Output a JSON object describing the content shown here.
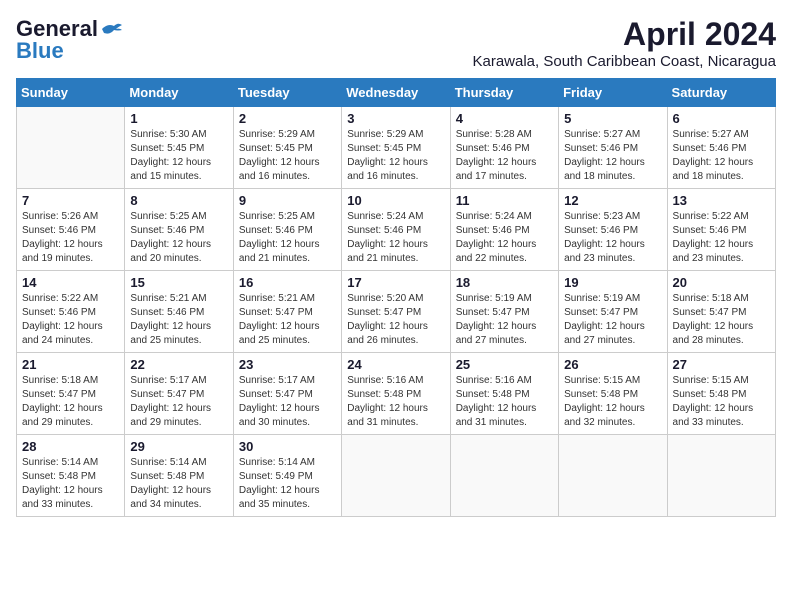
{
  "logo": {
    "general": "General",
    "blue": "Blue"
  },
  "title": "April 2024",
  "subtitle": "Karawala, South Caribbean Coast, Nicaragua",
  "headers": [
    "Sunday",
    "Monday",
    "Tuesday",
    "Wednesday",
    "Thursday",
    "Friday",
    "Saturday"
  ],
  "weeks": [
    [
      {
        "day": "",
        "info": ""
      },
      {
        "day": "1",
        "info": "Sunrise: 5:30 AM\nSunset: 5:45 PM\nDaylight: 12 hours\nand 15 minutes."
      },
      {
        "day": "2",
        "info": "Sunrise: 5:29 AM\nSunset: 5:45 PM\nDaylight: 12 hours\nand 16 minutes."
      },
      {
        "day": "3",
        "info": "Sunrise: 5:29 AM\nSunset: 5:45 PM\nDaylight: 12 hours\nand 16 minutes."
      },
      {
        "day": "4",
        "info": "Sunrise: 5:28 AM\nSunset: 5:46 PM\nDaylight: 12 hours\nand 17 minutes."
      },
      {
        "day": "5",
        "info": "Sunrise: 5:27 AM\nSunset: 5:46 PM\nDaylight: 12 hours\nand 18 minutes."
      },
      {
        "day": "6",
        "info": "Sunrise: 5:27 AM\nSunset: 5:46 PM\nDaylight: 12 hours\nand 18 minutes."
      }
    ],
    [
      {
        "day": "7",
        "info": "Sunrise: 5:26 AM\nSunset: 5:46 PM\nDaylight: 12 hours\nand 19 minutes."
      },
      {
        "day": "8",
        "info": "Sunrise: 5:25 AM\nSunset: 5:46 PM\nDaylight: 12 hours\nand 20 minutes."
      },
      {
        "day": "9",
        "info": "Sunrise: 5:25 AM\nSunset: 5:46 PM\nDaylight: 12 hours\nand 21 minutes."
      },
      {
        "day": "10",
        "info": "Sunrise: 5:24 AM\nSunset: 5:46 PM\nDaylight: 12 hours\nand 21 minutes."
      },
      {
        "day": "11",
        "info": "Sunrise: 5:24 AM\nSunset: 5:46 PM\nDaylight: 12 hours\nand 22 minutes."
      },
      {
        "day": "12",
        "info": "Sunrise: 5:23 AM\nSunset: 5:46 PM\nDaylight: 12 hours\nand 23 minutes."
      },
      {
        "day": "13",
        "info": "Sunrise: 5:22 AM\nSunset: 5:46 PM\nDaylight: 12 hours\nand 23 minutes."
      }
    ],
    [
      {
        "day": "14",
        "info": "Sunrise: 5:22 AM\nSunset: 5:46 PM\nDaylight: 12 hours\nand 24 minutes."
      },
      {
        "day": "15",
        "info": "Sunrise: 5:21 AM\nSunset: 5:46 PM\nDaylight: 12 hours\nand 25 minutes."
      },
      {
        "day": "16",
        "info": "Sunrise: 5:21 AM\nSunset: 5:47 PM\nDaylight: 12 hours\nand 25 minutes."
      },
      {
        "day": "17",
        "info": "Sunrise: 5:20 AM\nSunset: 5:47 PM\nDaylight: 12 hours\nand 26 minutes."
      },
      {
        "day": "18",
        "info": "Sunrise: 5:19 AM\nSunset: 5:47 PM\nDaylight: 12 hours\nand 27 minutes."
      },
      {
        "day": "19",
        "info": "Sunrise: 5:19 AM\nSunset: 5:47 PM\nDaylight: 12 hours\nand 27 minutes."
      },
      {
        "day": "20",
        "info": "Sunrise: 5:18 AM\nSunset: 5:47 PM\nDaylight: 12 hours\nand 28 minutes."
      }
    ],
    [
      {
        "day": "21",
        "info": "Sunrise: 5:18 AM\nSunset: 5:47 PM\nDaylight: 12 hours\nand 29 minutes."
      },
      {
        "day": "22",
        "info": "Sunrise: 5:17 AM\nSunset: 5:47 PM\nDaylight: 12 hours\nand 29 minutes."
      },
      {
        "day": "23",
        "info": "Sunrise: 5:17 AM\nSunset: 5:47 PM\nDaylight: 12 hours\nand 30 minutes."
      },
      {
        "day": "24",
        "info": "Sunrise: 5:16 AM\nSunset: 5:48 PM\nDaylight: 12 hours\nand 31 minutes."
      },
      {
        "day": "25",
        "info": "Sunrise: 5:16 AM\nSunset: 5:48 PM\nDaylight: 12 hours\nand 31 minutes."
      },
      {
        "day": "26",
        "info": "Sunrise: 5:15 AM\nSunset: 5:48 PM\nDaylight: 12 hours\nand 32 minutes."
      },
      {
        "day": "27",
        "info": "Sunrise: 5:15 AM\nSunset: 5:48 PM\nDaylight: 12 hours\nand 33 minutes."
      }
    ],
    [
      {
        "day": "28",
        "info": "Sunrise: 5:14 AM\nSunset: 5:48 PM\nDaylight: 12 hours\nand 33 minutes."
      },
      {
        "day": "29",
        "info": "Sunrise: 5:14 AM\nSunset: 5:48 PM\nDaylight: 12 hours\nand 34 minutes."
      },
      {
        "day": "30",
        "info": "Sunrise: 5:14 AM\nSunset: 5:49 PM\nDaylight: 12 hours\nand 35 minutes."
      },
      {
        "day": "",
        "info": ""
      },
      {
        "day": "",
        "info": ""
      },
      {
        "day": "",
        "info": ""
      },
      {
        "day": "",
        "info": ""
      }
    ]
  ]
}
